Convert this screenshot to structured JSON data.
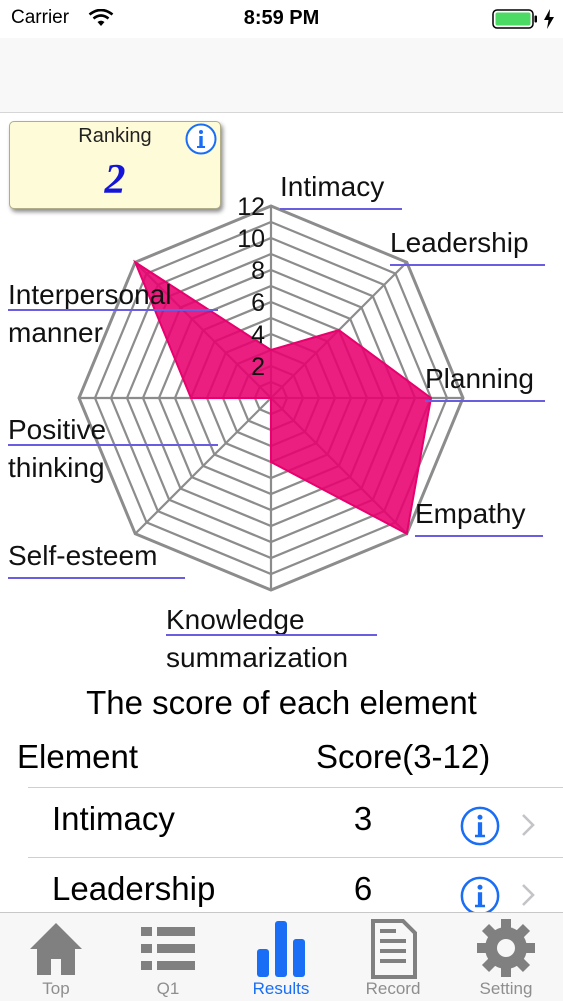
{
  "status_bar": {
    "carrier": "Carrier",
    "time": "8:59 PM"
  },
  "ranking": {
    "label": "Ranking",
    "value": "2"
  },
  "chart_data": {
    "type": "radar",
    "axes": [
      "Intimacy",
      "Leadership",
      "Planning",
      "Empathy",
      "Knowledge summarization",
      "Self-esteem",
      "Positive thinking",
      "Interpersonal manner"
    ],
    "ticks": [
      "2",
      "4",
      "6",
      "8",
      "10",
      "12"
    ],
    "range": [
      0,
      12
    ],
    "values": [
      3,
      6,
      10,
      12,
      4,
      0,
      5,
      12
    ],
    "fill_color": "#e8006e"
  },
  "radar_labels": {
    "intimacy": "Intimacy",
    "leadership": "Leadership",
    "planning": "Planning",
    "empathy": "Empathy",
    "knowledge_line1": "Knowledge",
    "knowledge_line2": "summarization",
    "self_esteem": "Self-esteem",
    "positive_line1": "Positive",
    "positive_line2": "thinking",
    "interpersonal_line1": "Interpersonal",
    "interpersonal_line2": "manner"
  },
  "score_table": {
    "title": "The score of each element",
    "element_header": "Element",
    "score_header": "Score(3-12)",
    "rows": [
      {
        "label": "Intimacy",
        "score": "3"
      },
      {
        "label": "Leadership",
        "score": "6"
      }
    ]
  },
  "tab_bar": {
    "tabs": [
      {
        "label": "Top",
        "icon": "home-icon"
      },
      {
        "label": "Q1",
        "icon": "list-icon"
      },
      {
        "label": "Results",
        "icon": "bar-chart-icon"
      },
      {
        "label": "Record",
        "icon": "document-icon"
      },
      {
        "label": "Setting",
        "icon": "gear-icon"
      }
    ],
    "active_tab": "Results"
  },
  "colors": {
    "accent": "#1a6ef5",
    "radar_fill": "#e8006e",
    "link_underline": "#6a5de0",
    "ranking_value": "#1515d9"
  }
}
